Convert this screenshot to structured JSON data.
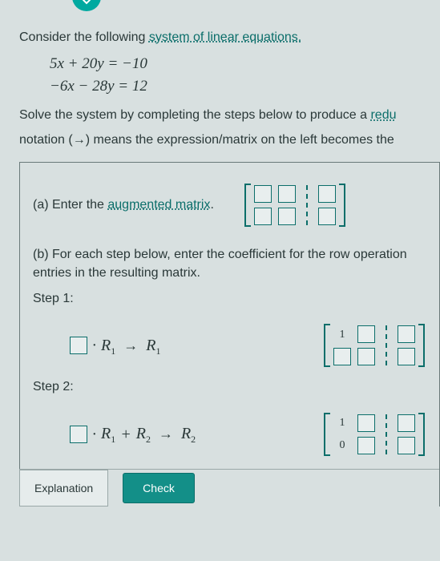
{
  "topIcon": "chevron-down",
  "intro": {
    "prefix": "Consider the following ",
    "link": "system of linear equations."
  },
  "equations": {
    "line1": "5x + 20y = −10",
    "line2": "−6x − 28y = 12"
  },
  "solveText": {
    "p1a": "Solve the system by completing the steps below to produce a ",
    "p1link": "redu",
    "p2a": "notation (",
    "p2arrow": "→",
    "p2b": ") means the expression/matrix on the left becomes the"
  },
  "partA": {
    "prefix": "(a) Enter the ",
    "link": "augmented matrix",
    "suffix": ".",
    "matrix": {
      "rows": [
        {
          "c1": "",
          "c2": "",
          "aug": ""
        },
        {
          "c1": "",
          "c2": "",
          "aug": ""
        }
      ]
    }
  },
  "partB": {
    "text": "(b) For each step below, enter the coefficient for the row operation entries in the resulting matrix."
  },
  "step1": {
    "label": "Step 1:",
    "coef": "",
    "op": {
      "r1a": "R",
      "s1a": "1",
      "arrow": "→",
      "r1b": "R",
      "s1b": "1"
    },
    "matrix": {
      "rows": [
        {
          "c1": "1",
          "c1fixed": true,
          "c2": "",
          "aug": ""
        },
        {
          "c1": "",
          "c1fixed": false,
          "c2": "",
          "aug": ""
        }
      ]
    }
  },
  "step2": {
    "label": "Step 2:",
    "coef": "",
    "op": {
      "r1a": "R",
      "s1a": "1",
      "plus": "+",
      "r2a": "R",
      "s2a": "2",
      "arrow": "→",
      "r2b": "R",
      "s2b": "2"
    },
    "matrix": {
      "rows": [
        {
          "c1": "1",
          "c1fixed": true,
          "c2": "",
          "aug": ""
        },
        {
          "c1": "0",
          "c1fixed": true,
          "c2": "",
          "aug": ""
        }
      ]
    }
  },
  "buttons": {
    "explanation": "Explanation",
    "check": "Check"
  }
}
